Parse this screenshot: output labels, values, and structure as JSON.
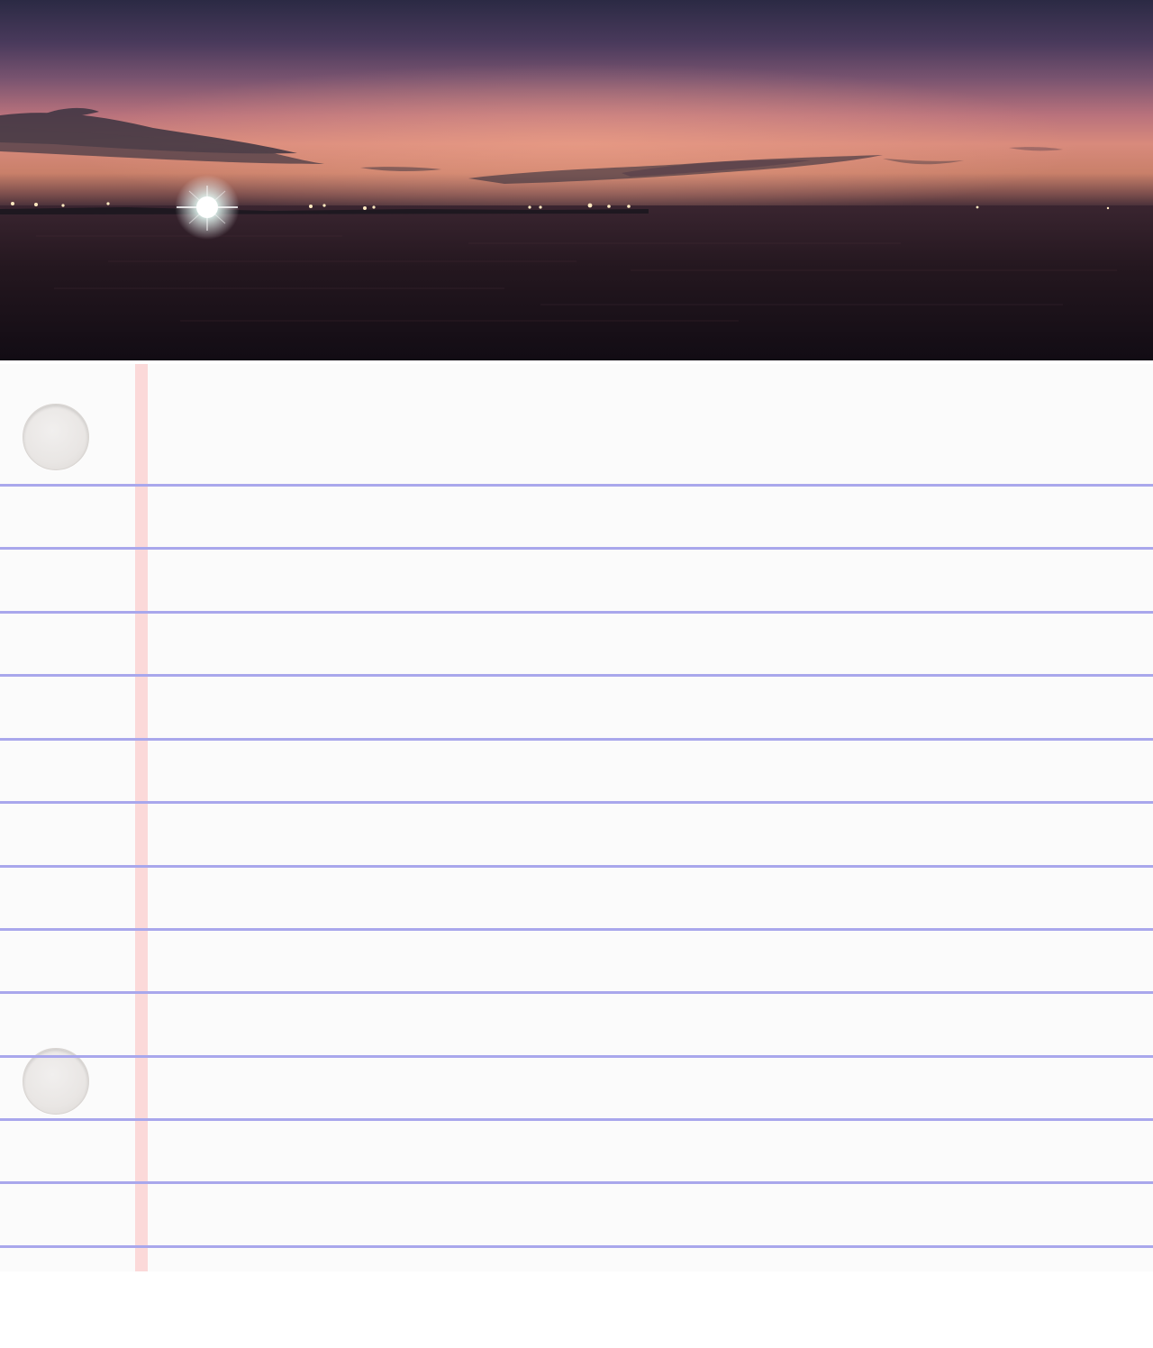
{
  "hero_image": {
    "subject": "sunset-over-sea-photo",
    "colors": {
      "sky_top": "#2b2a44",
      "sky_glow": "#d88a7c",
      "sea": "#1c131d"
    }
  },
  "notebook": {
    "paper_color": "#fbfbfb",
    "rule_color": "#a9a7ec",
    "margin_color": "#fbd9d9",
    "punch_holes": 2,
    "ruled_lines": 13,
    "text_lines": []
  }
}
